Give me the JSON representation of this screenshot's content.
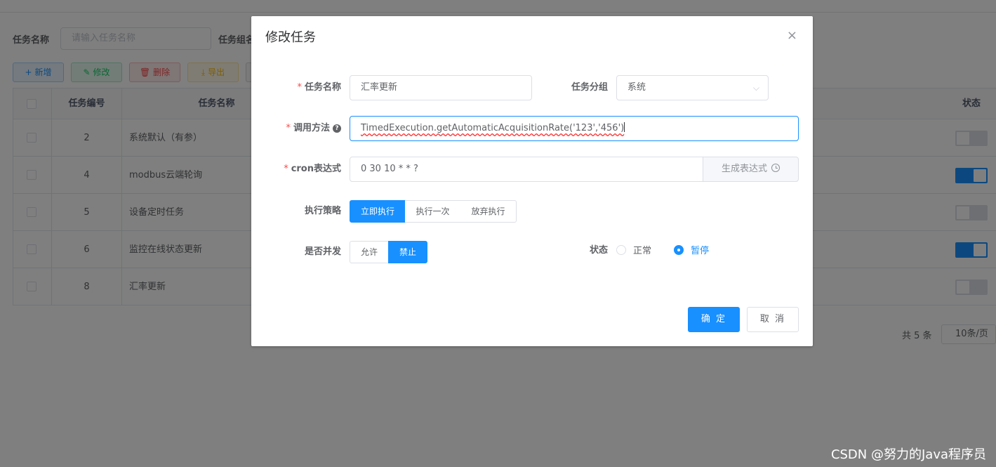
{
  "filters": {
    "task_name_label": "任务名称",
    "task_name_placeholder": "请输入任务名称",
    "task_group_label": "任务组名"
  },
  "toolbar": {
    "add_label": "新增",
    "edit_label": "修改",
    "delete_label": "删除",
    "export_label": "导出"
  },
  "table": {
    "columns": [
      "任务编号",
      "任务名称",
      "状态"
    ],
    "rows": [
      {
        "id": "2",
        "name": "系统默认（有参）",
        "status_on": false
      },
      {
        "id": "4",
        "name": "modbus云端轮询",
        "status_on": true
      },
      {
        "id": "5",
        "name": "设备定时任务",
        "status_on": false
      },
      {
        "id": "6",
        "name": "监控在线状态更新",
        "status_on": true
      },
      {
        "id": "8",
        "name": "汇率更新",
        "status_on": false
      }
    ]
  },
  "pagination": {
    "total": "共 5 条",
    "page_size": "10条/页"
  },
  "dialog": {
    "title": "修改任务",
    "close_icon": "×",
    "fields": {
      "task_name": {
        "label": "任务名称",
        "value": "汇率更新"
      },
      "task_group": {
        "label": "任务分组",
        "value": "系统"
      },
      "invoke_target": {
        "label": "调用方法",
        "value": "TimedExecution.getAutomaticAcquisitionRate('123','456')"
      },
      "cron": {
        "label": "cron表达式",
        "value": "0 30 10 * * ?",
        "append_label": "生成表达式"
      },
      "misfire_policy": {
        "label": "执行策略",
        "options": [
          "立即执行",
          "执行一次",
          "放弃执行"
        ],
        "selected": "立即执行"
      },
      "concurrent": {
        "label": "是否并发",
        "options": [
          "允许",
          "禁止"
        ],
        "selected": "禁止"
      },
      "status": {
        "label": "状态",
        "options": [
          "正常",
          "暂停"
        ],
        "selected": "暂停"
      }
    },
    "ok_label": "确 定",
    "cancel_label": "取 消"
  },
  "watermark": "CSDN @努力的Java程序员",
  "colors": {
    "primary": "#1890ff",
    "danger": "#ff4949",
    "success": "#13ce66",
    "warning": "#ffba00",
    "mask": "rgba(0,0,0,0.5)"
  }
}
